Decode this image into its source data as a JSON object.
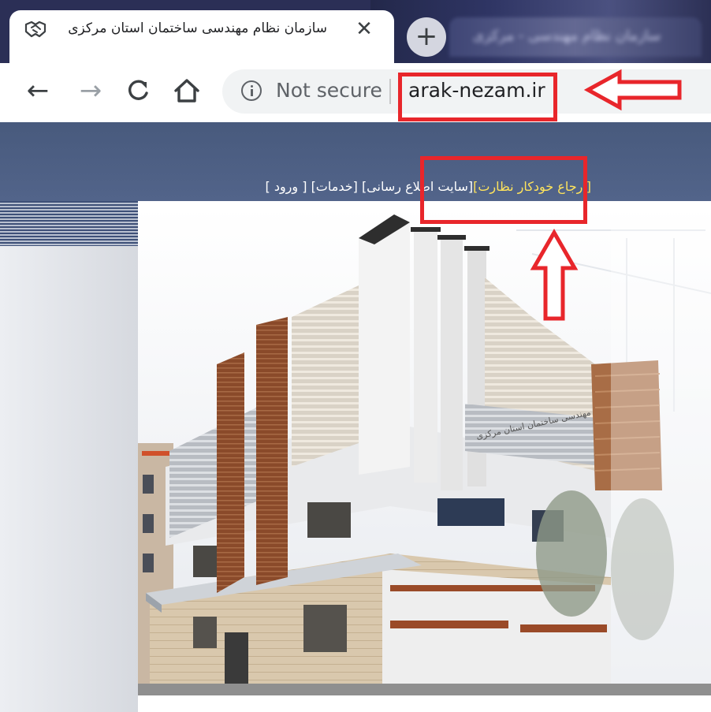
{
  "browser": {
    "active_tab": {
      "title": "سازمان نظام مهندسی ساختمان استان مرکزی",
      "close_glyph": "✕",
      "favicon": "handshake-icon"
    },
    "background_tab": {
      "title": "سازمان نظام مهندسی - مرکزی"
    },
    "new_tab_glyph": "+",
    "nav": {
      "back_glyph": "←",
      "forward_glyph": "→",
      "reload_glyph": "C",
      "home_glyph": "⌂"
    },
    "omnibox": {
      "security_text": "Not secure",
      "url": "arak-nezam.ir"
    }
  },
  "site": {
    "nav_links": {
      "referral": "[ارجاع خودکار نظارت]",
      "info_site": "[سایت اطلاع رسانی]",
      "services": "[خدمات]",
      "login": "[ ورود ]"
    },
    "building_sign": "سازمان نظام مهندسی ساختمان استان مرکزی"
  },
  "colors": {
    "tabstrip": "#2b2f56",
    "header": "#4d5f84",
    "highlight_red": "#e8262b",
    "link_yellow": "#ffe45c"
  }
}
